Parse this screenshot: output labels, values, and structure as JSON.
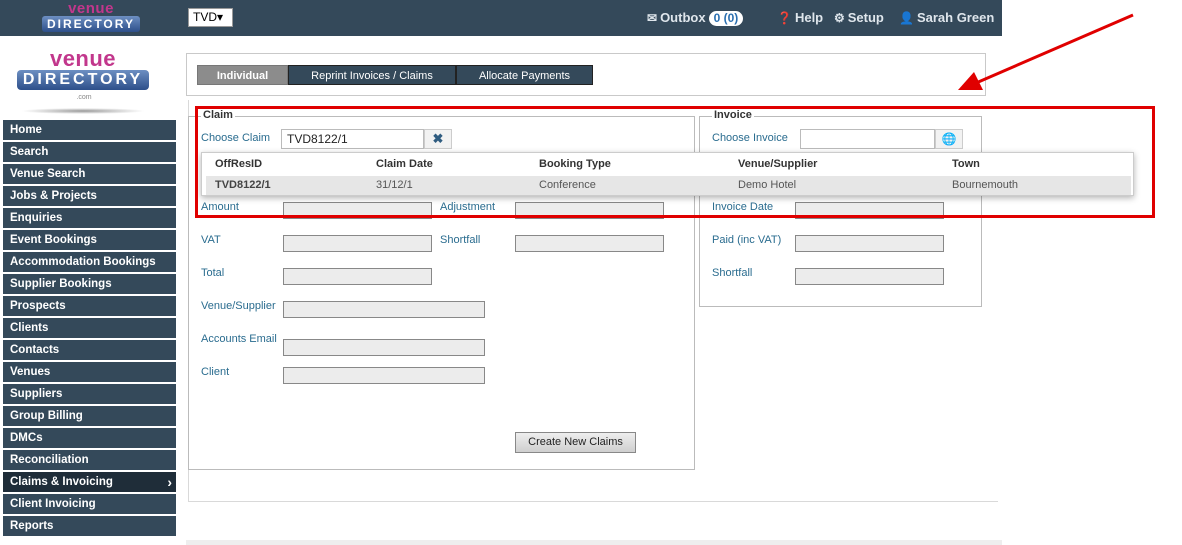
{
  "topbar": {
    "logo_top": "venue",
    "logo_bottom": "DIRECTORY",
    "account_select": "TVD",
    "outbox_label": "Outbox",
    "outbox_count": "0 (0)",
    "help_label": "Help",
    "setup_label": "Setup",
    "user_name": "Sarah Green"
  },
  "side_logo": {
    "top": "venue",
    "bottom": "DIRECTORY",
    "suffix": ".com"
  },
  "sidebar": {
    "items": [
      {
        "label": "Home"
      },
      {
        "label": "Search"
      },
      {
        "label": "Venue Search"
      },
      {
        "label": "Jobs & Projects"
      },
      {
        "label": "Enquiries"
      },
      {
        "label": "Event Bookings"
      },
      {
        "label": "Accommodation Bookings"
      },
      {
        "label": "Supplier Bookings"
      },
      {
        "label": "Prospects"
      },
      {
        "label": "Clients"
      },
      {
        "label": "Contacts"
      },
      {
        "label": "Venues"
      },
      {
        "label": "Suppliers"
      },
      {
        "label": "Group Billing"
      },
      {
        "label": "DMCs"
      },
      {
        "label": "Reconciliation"
      },
      {
        "label": "Claims & Invoicing",
        "active": true
      },
      {
        "label": "Client Invoicing"
      },
      {
        "label": "Reports"
      }
    ]
  },
  "tabs": [
    {
      "label": "Individual",
      "active": true
    },
    {
      "label": "Reprint Invoices / Claims"
    },
    {
      "label": "Allocate Payments"
    }
  ],
  "claim": {
    "legend": "Claim",
    "choose_label": "Choose Claim",
    "choose_value": "TVD8122/1",
    "amount_label": "Amount",
    "adjustment_label": "Adjustment",
    "vat_label": "VAT",
    "shortfall_label": "Shortfall",
    "total_label": "Total",
    "venue_label": "Venue/Supplier",
    "email_label": "Accounts Email",
    "client_label": "Client",
    "create_button": "Create New Claims"
  },
  "invoice": {
    "legend": "Invoice",
    "choose_label": "Choose Invoice",
    "invoice_date_label": "Invoice Date",
    "paid_label": "Paid (inc VAT)",
    "shortfall_label": "Shortfall"
  },
  "results": {
    "headers": [
      "OffResID",
      "Claim Date",
      "Booking Type",
      "Venue/Supplier",
      "Town"
    ],
    "row": [
      "TVD8122/1",
      "31/12/1",
      "Conference",
      "Demo Hotel",
      "Bournemouth"
    ]
  },
  "colors": {
    "nav_bg": "#34495a",
    "label_blue": "#2a6c8f",
    "annotation_red": "#e00000",
    "logo_pink": "#c2378c"
  }
}
